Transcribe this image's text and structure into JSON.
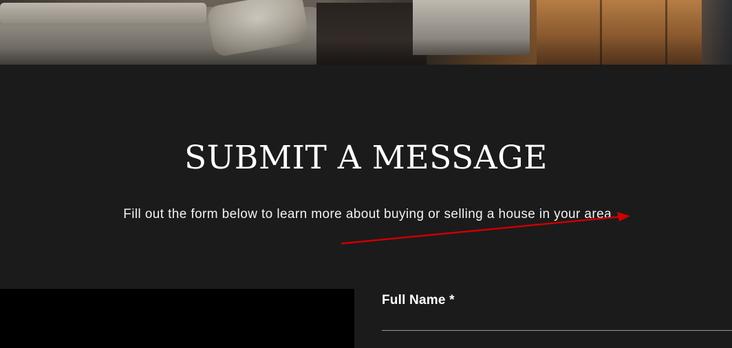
{
  "section": {
    "heading": "SUBMIT A MESSAGE",
    "intro": "Fill out the form below to learn more about buying or selling a house in your area."
  },
  "form": {
    "full_name_label": "Full Name *",
    "full_name_value": ""
  },
  "colors": {
    "background": "#1b1b1b",
    "text": "#ffffff",
    "annotation_arrow": "#cc0000",
    "left_panel": "#000000"
  }
}
